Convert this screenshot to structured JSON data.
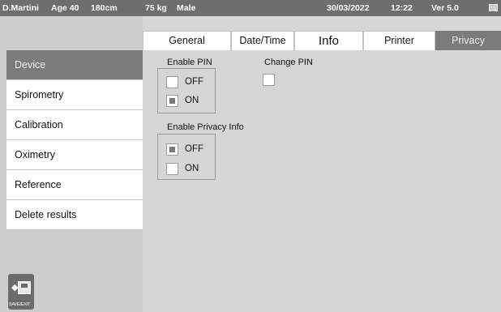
{
  "header": {
    "patient": "D.Martini",
    "age": "Age 40",
    "height": "180cm",
    "weight": "75 kg",
    "sex": "Male",
    "date": "30/03/2022",
    "time": "12:22",
    "version": "Ver 5.0"
  },
  "tabs": [
    {
      "label": "General"
    },
    {
      "label": "Date/Time"
    },
    {
      "label": "Info"
    },
    {
      "label": "Printer"
    },
    {
      "label": "Privacy"
    }
  ],
  "sidebar": {
    "items": [
      {
        "label": "Device"
      },
      {
        "label": "Spirometry"
      },
      {
        "label": "Calibration"
      },
      {
        "label": "Oximetry"
      },
      {
        "label": "Reference"
      },
      {
        "label": "Delete results"
      }
    ],
    "save_exit_label": "SAVE/EXIT"
  },
  "privacy": {
    "enable_pin": {
      "label": "Enable PIN",
      "options": [
        {
          "label": "OFF",
          "checked": false
        },
        {
          "label": "ON",
          "checked": true
        }
      ]
    },
    "change_pin": {
      "label": "Change PIN",
      "checked": false
    },
    "enable_privacy_info": {
      "label": "Enable Privacy Info",
      "options": [
        {
          "label": "OFF",
          "checked": true
        },
        {
          "label": "ON",
          "checked": false
        }
      ]
    }
  },
  "colors": {
    "header_bg": "#6e6e6e",
    "active_bg": "#7b7b7b",
    "panel_bg": "#d6d6d6"
  }
}
